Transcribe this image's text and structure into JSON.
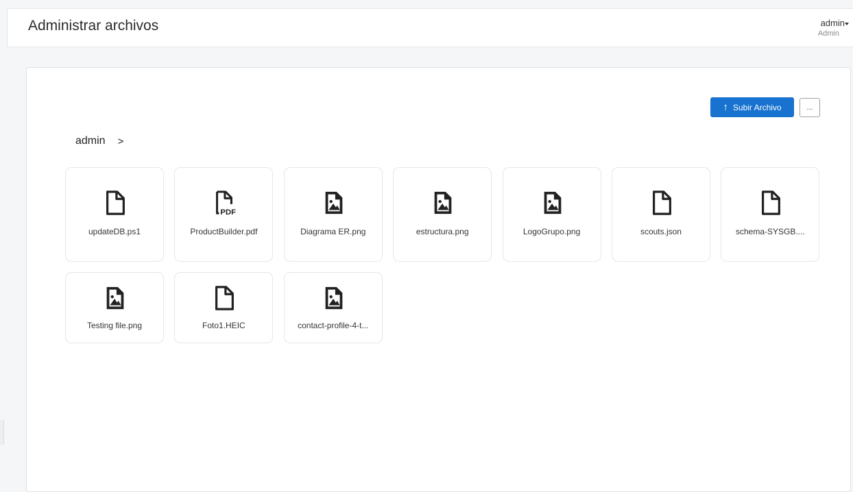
{
  "header": {
    "title": "Administrar archivos",
    "user_name": "admin",
    "user_role": "Admin"
  },
  "toolbar": {
    "upload_label": "Subir Archivo",
    "upload_icon": "arrow-up-icon",
    "more_label": "...",
    "accent": "#1872d0"
  },
  "breadcrumb": {
    "root": "admin",
    "separator": ">"
  },
  "files": [
    {
      "name": "updateDB.ps1",
      "icon": "file-icon"
    },
    {
      "name": "ProductBuilder.pdf",
      "icon": "pdf-file-icon"
    },
    {
      "name": "Diagrama ER.png",
      "icon": "image-file-icon"
    },
    {
      "name": "estructura.png",
      "icon": "image-file-icon"
    },
    {
      "name": "LogoGrupo.png",
      "icon": "image-file-icon"
    },
    {
      "name": "scouts.json",
      "icon": "file-icon"
    },
    {
      "name": "schema-SYSGB....",
      "icon": "file-icon"
    },
    {
      "name": "Testing file.png",
      "icon": "image-file-icon"
    },
    {
      "name": "Foto1.HEIC",
      "icon": "file-icon"
    },
    {
      "name": "contact-profile-4-t...",
      "icon": "image-file-icon"
    }
  ]
}
